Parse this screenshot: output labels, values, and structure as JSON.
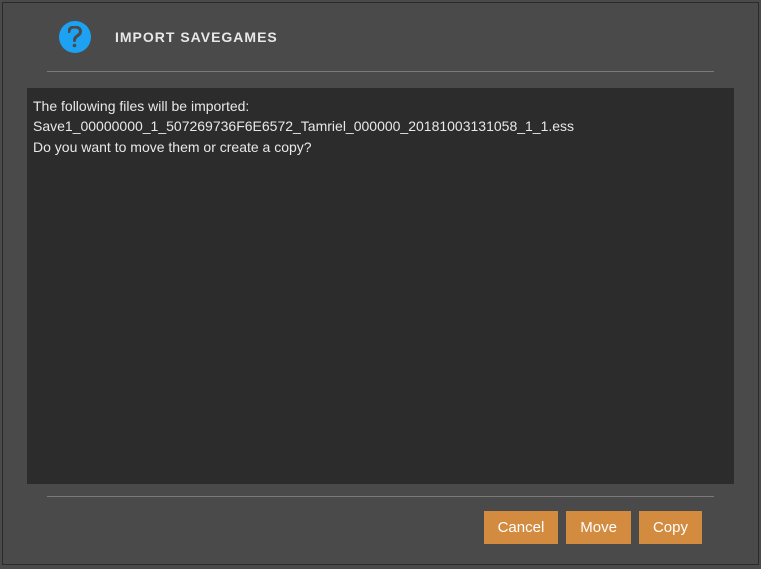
{
  "header": {
    "title": "IMPORT SAVEGAMES"
  },
  "content": {
    "intro": "The following files will be imported:",
    "file": "Save1_00000000_1_507269736F6E6572_Tamriel_000000_20181003131058_1_1.ess",
    "question": "Do you want to move them or create a copy?"
  },
  "buttons": {
    "cancel": "Cancel",
    "move": "Move",
    "copy": "Copy"
  }
}
